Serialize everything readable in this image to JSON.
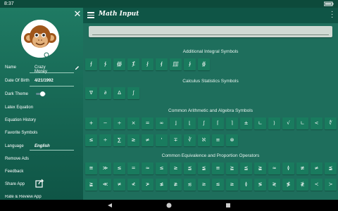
{
  "status": {
    "time": "8:37"
  },
  "drawer": {
    "fields": [
      {
        "label": "Name",
        "value": "Crazy Money"
      },
      {
        "label": "Date Of Birth",
        "value": "4/21/1992"
      },
      {
        "label": "Dark Theme"
      },
      {
        "label": "Latex Equation"
      },
      {
        "label": "Equation History"
      },
      {
        "label": "Favorite Symbols"
      },
      {
        "label": "Language",
        "value": "English"
      },
      {
        "label": "Remove Ads"
      },
      {
        "label": "Feedback"
      },
      {
        "label": "Share App"
      },
      {
        "label": "Rate & Review App"
      }
    ]
  },
  "appbar": {
    "title": "Math Input"
  },
  "sections": [
    {
      "heading": "Additional Integral Symbols",
      "symbols": [
        "⨍",
        "∱",
        "∰",
        "⨋",
        "⨏",
        "⨐",
        "⨌",
        "⨑",
        "∯"
      ]
    },
    {
      "heading": "Calculus Statistics Symbols",
      "symbols": [
        "∇",
        "∂",
        "Δ",
        "∫"
      ]
    },
    {
      "heading": "Common Arithmetic and Algebra Symbols",
      "symbols": [
        "+",
        "−",
        "÷",
        "×",
        "=",
        "∞",
        "⌋",
        "⌊",
        "∫",
        "⌈",
        "⌉",
        "±",
        "∟",
        "⟩",
        "√",
        "∟",
        "<",
        "∜",
        "≤",
        "÷",
        "∑",
        "≥",
        "≠",
        "'",
        "∓",
        "∛",
        "ℵ",
        "≡",
        "⊗"
      ]
    },
    {
      "heading": "Common Equivalence and Proportion Operators",
      "symbols": [
        "≅",
        "≫",
        "≤",
        "=",
        "≈",
        "≤",
        "≥",
        "≦",
        "≨",
        "≡",
        "≧",
        "≦",
        "≩",
        "≈",
        "≬",
        "≢",
        "≠",
        "≨",
        "≩",
        "≪",
        "≭",
        "≮",
        "≯",
        "≰",
        "≱",
        "≲",
        "≳",
        "≤",
        "≥",
        "≬",
        "≶",
        "≷",
        "≸",
        "≹",
        "≺",
        "≻",
        "≪",
        "≫",
        "≥"
      ]
    }
  ]
}
